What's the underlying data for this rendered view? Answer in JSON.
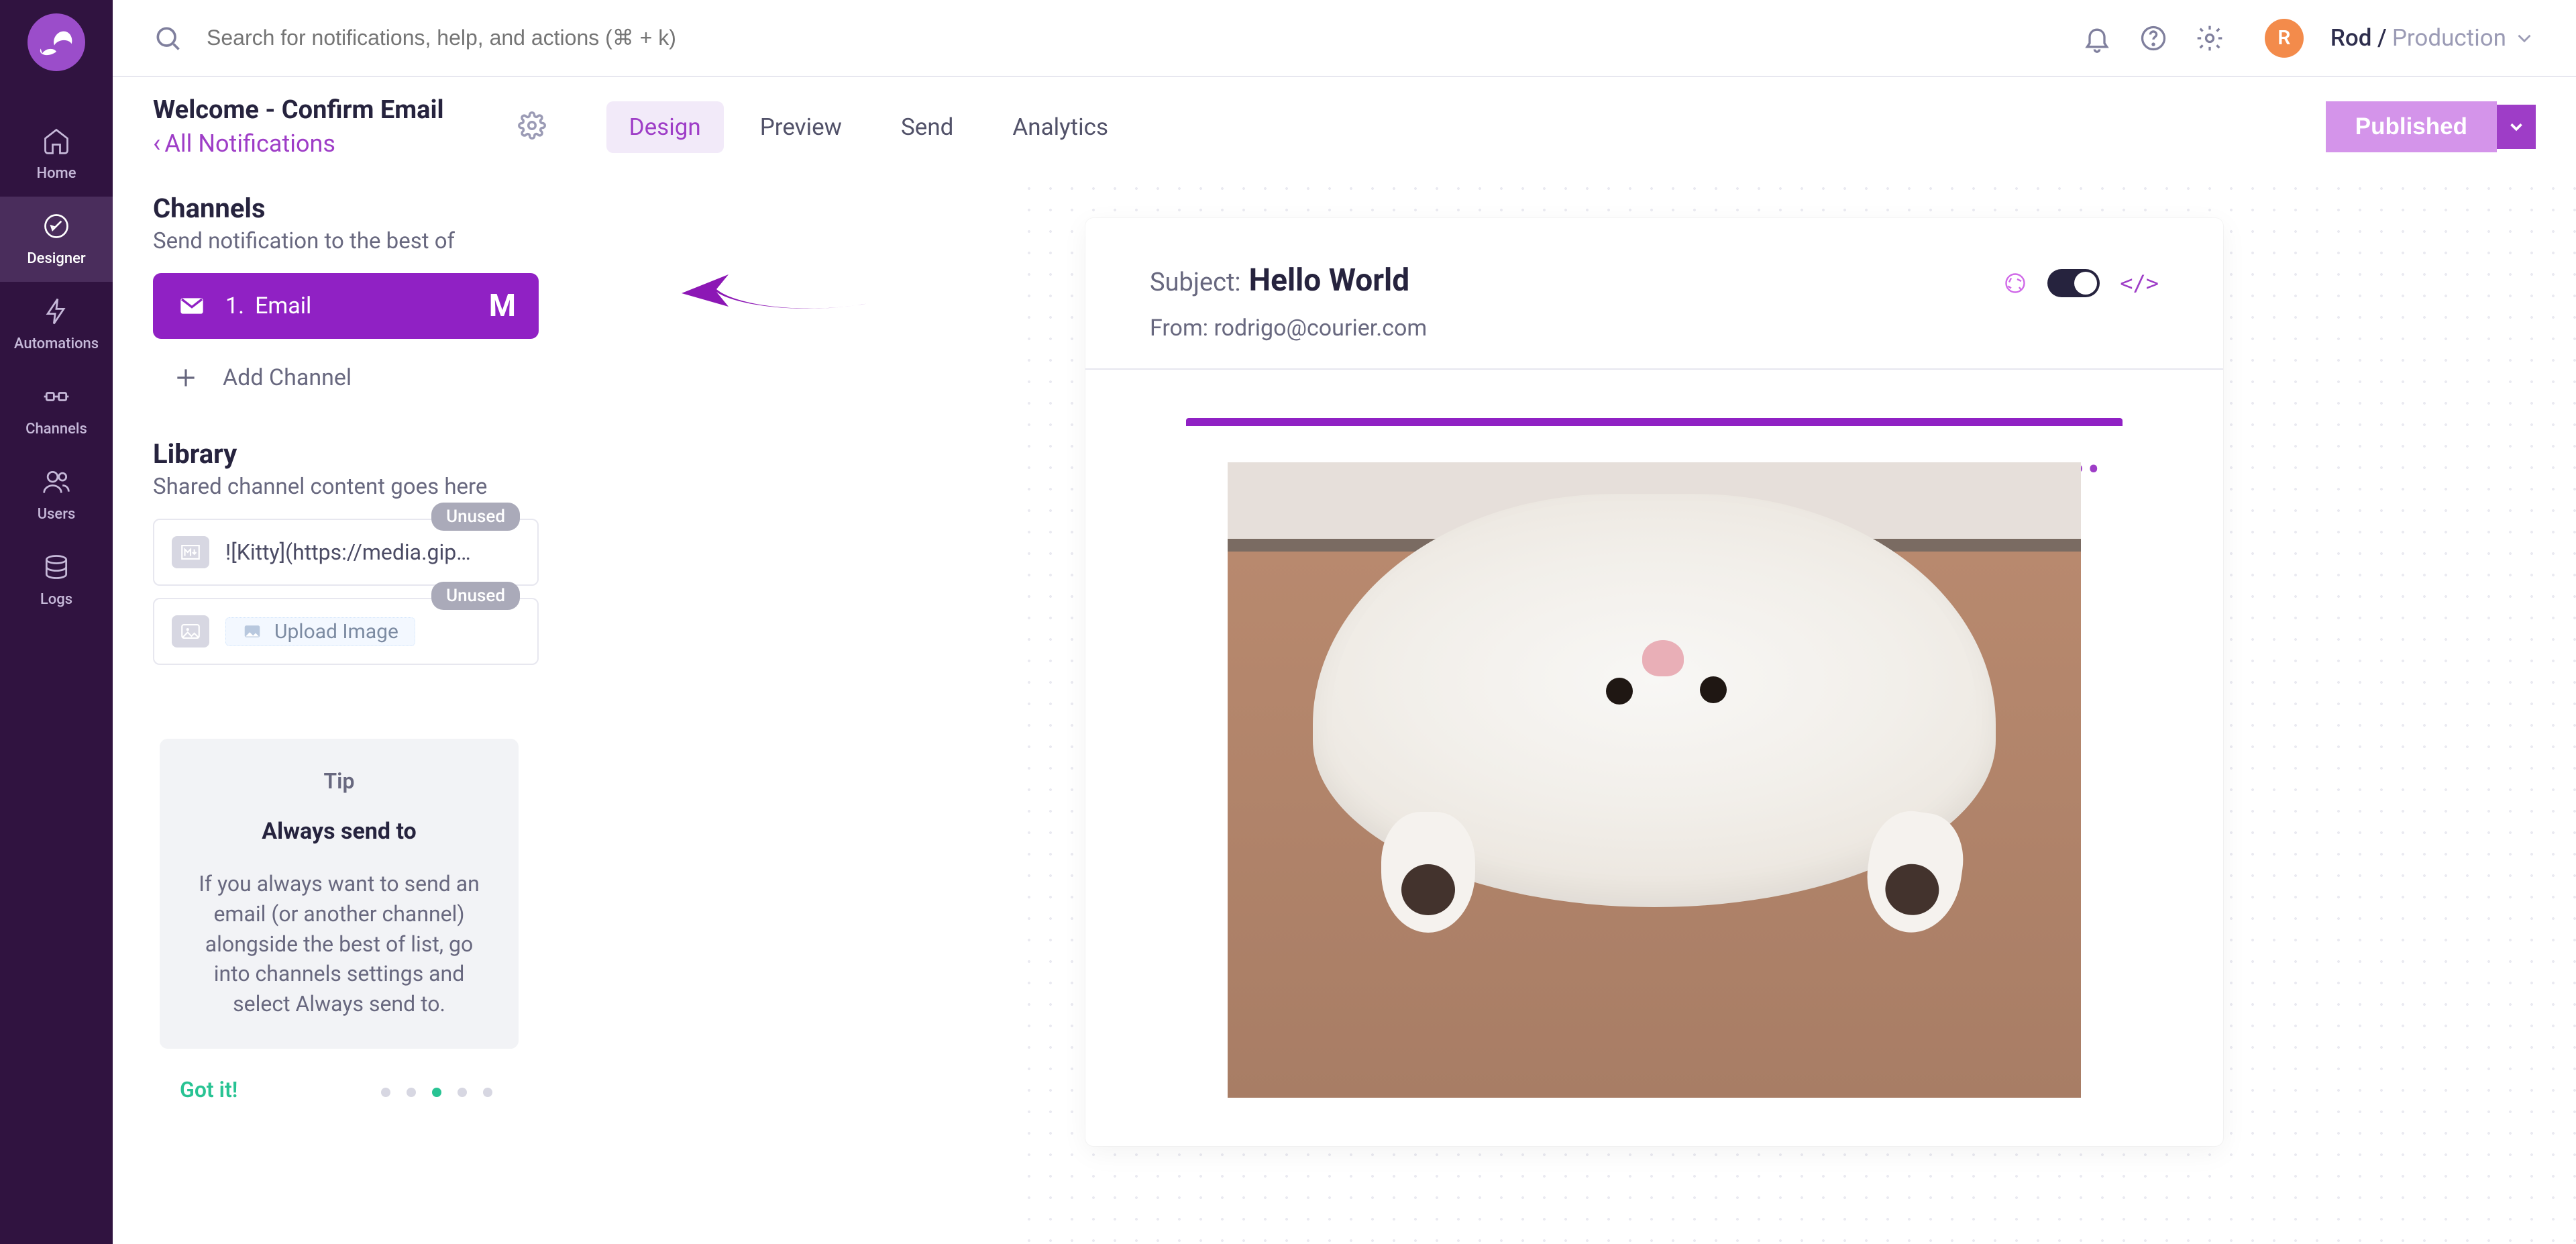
{
  "search": {
    "placeholder": "Search for notifications, help, and actions (⌘ + k)"
  },
  "user": {
    "initial": "R",
    "name": "Rod",
    "env": "Production"
  },
  "header": {
    "title": "Welcome - Confirm Email",
    "breadcrumb": "All Notifications",
    "tabs": [
      "Design",
      "Preview",
      "Send",
      "Analytics"
    ],
    "active_tab": "Design",
    "publish_btn": "Published"
  },
  "sidebar_nav": [
    "Home",
    "Designer",
    "Automations",
    "Channels",
    "Users",
    "Logs"
  ],
  "channels": {
    "title": "Channels",
    "subtitle": "Send notification to the best of",
    "items": [
      {
        "index": "1.",
        "label": "Email",
        "provider_badge": "M"
      }
    ],
    "add_label": "Add Channel"
  },
  "library": {
    "title": "Library",
    "subtitle": "Shared channel content goes here",
    "items": [
      {
        "text": "![Kitty](https://media.gip…",
        "badge": "Unused",
        "kind": "markdown"
      },
      {
        "text": "Upload Image",
        "badge": "Unused",
        "kind": "image"
      }
    ]
  },
  "tip": {
    "label": "Tip",
    "title": "Always send to",
    "body": "If you always want to send an email (or another channel) alongside the best of list, go into channels settings and select Always send to.",
    "got_it": "Got it!"
  },
  "email": {
    "subject_label": "Subject:",
    "subject": "Hello World",
    "from_label": "From:",
    "from": "rodrigo@courier.com",
    "code_tag": "</>"
  }
}
